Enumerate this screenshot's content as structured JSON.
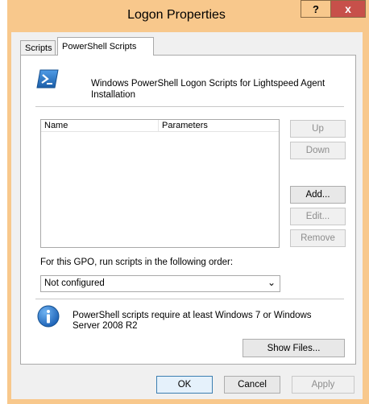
{
  "window": {
    "title": "Logon Properties",
    "help_label": "?",
    "close_label": "x"
  },
  "tabs": [
    {
      "label": "Scripts"
    },
    {
      "label": "PowerShell Scripts"
    }
  ],
  "panel": {
    "header_text": "Windows PowerShell Logon Scripts for Lightspeed Agent Installation",
    "list": {
      "columns": [
        "Name",
        "Parameters"
      ]
    },
    "buttons": {
      "up": "Up",
      "down": "Down",
      "add": "Add...",
      "edit": "Edit...",
      "remove": "Remove",
      "show_files": "Show Files..."
    },
    "order_label": "For this GPO, run scripts in the following order:",
    "order_select": {
      "value": "Not configured"
    },
    "info_text": "PowerShell scripts require at least Windows 7 or Windows Server 2008 R2"
  },
  "footer": {
    "ok": "OK",
    "cancel": "Cancel",
    "apply": "Apply"
  },
  "colors": {
    "frame": "#f8c88c",
    "close_button": "#c7504a",
    "powershell_blue": "#2d74c6"
  }
}
